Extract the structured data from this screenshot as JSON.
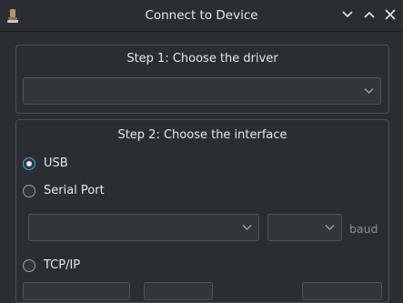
{
  "window": {
    "title": "Connect to Device",
    "icons": [
      "app-icon",
      "chevron-down-icon",
      "chevron-up-icon",
      "close-icon"
    ]
  },
  "step1": {
    "title": "Step 1: Choose the driver",
    "driver_value": ""
  },
  "step2": {
    "title": "Step 2: Choose the interface",
    "options": [
      {
        "label": "USB",
        "checked": true
      },
      {
        "label": "Serial Port",
        "checked": false
      },
      {
        "label": "TCP/IP",
        "checked": false
      }
    ],
    "serial_port_value": "",
    "baud_value": "",
    "baud_label": "baud"
  },
  "colors": {
    "background": "#2a2e32",
    "accent": "#3daee9",
    "border": "#4a4f55"
  }
}
